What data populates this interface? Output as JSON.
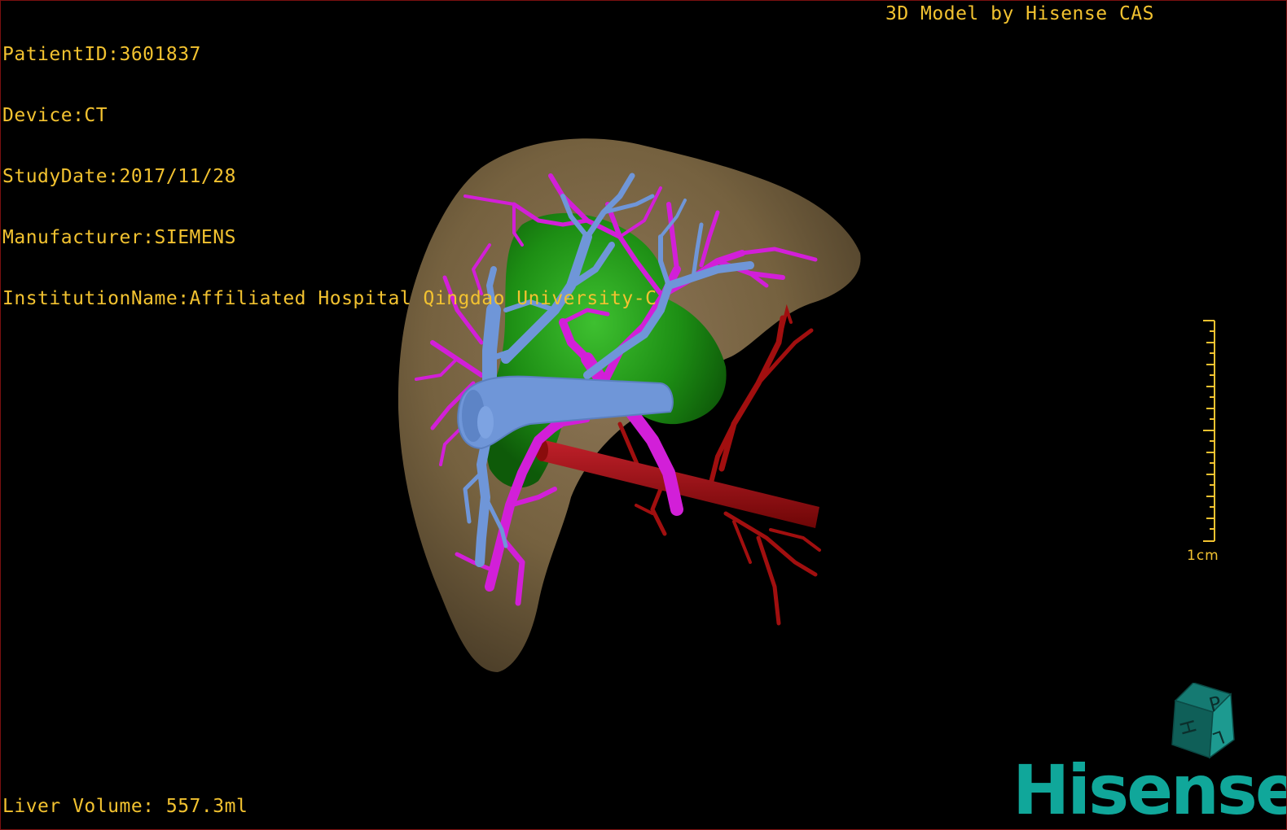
{
  "overlay": {
    "patient_id": "PatientID:3601837",
    "device": "Device:CT",
    "study_date": "StudyDate:2017/11/28",
    "manufacturer": "Manufacturer:SIEMENS",
    "institution": "InstitutionName:Affiliated Hospital Qingdao University-C",
    "model_credit": "3D Model by Hisense CAS",
    "liver_volume": "Liver Volume: 557.3ml"
  },
  "scale_bar": {
    "label": "1cm"
  },
  "orientation_cube": {
    "faces": [
      "P",
      "H",
      "L"
    ]
  },
  "brand": {
    "logo_text": "Hisense"
  },
  "colors": {
    "overlay_text": "#f2c230",
    "liver": "#7a6547",
    "tumor": "#1f8c14",
    "hepatic_vein": "#6f96d8",
    "portal_vein": "#d21fd8",
    "artery": "#a10f0f",
    "brand": "#10a79a"
  }
}
